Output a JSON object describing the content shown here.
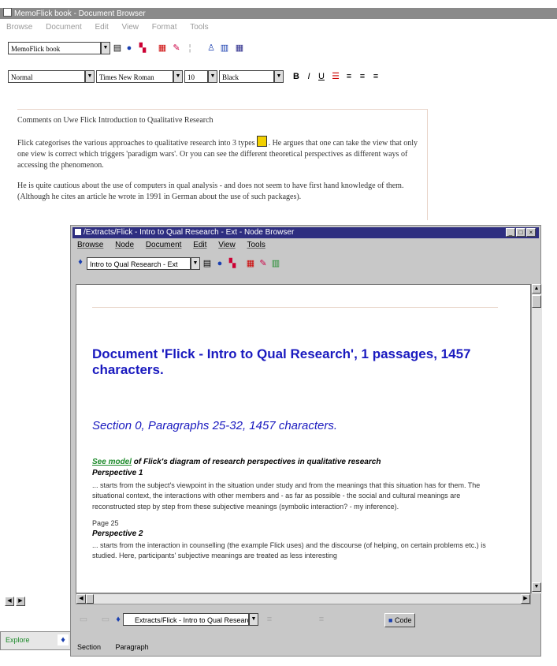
{
  "outer_window": {
    "title": "MemoFlick book - Document Browser",
    "menu": [
      "Browse",
      "Document",
      "Edit",
      "View",
      "Format",
      "Tools"
    ],
    "toolbar_top": {
      "document_combo": "MemoFlick book"
    },
    "toolbar_format": {
      "style_combo": "Normal",
      "font_combo": "Times New Roman",
      "size_combo": "10",
      "color_combo": "Black"
    },
    "document": {
      "heading": "Comments on Uwe Flick Introduction to Qualitative Research",
      "paragraph_1a": "Flick categorises the various approaches to qualitative research into 3 types",
      "paragraph_1b": ". He argues that one can take the view that only one view is correct which triggers 'paradigm wars'. Or you can see the different theoretical perspectives as different ways of accessing the phenomenon.",
      "paragraph_2": "He is quite cautious about the use of computers in qual analysis - and does not seem to have first hand knowledge of them. (Although he cites an article he wrote in 1991 in German about the use of such packages)."
    }
  },
  "inner_window": {
    "title": "/Extracts/Flick - Intro to Qual Research - Ext - Node Browser",
    "menu": [
      "Browse",
      "Node",
      "Document",
      "Edit",
      "View",
      "Tools"
    ],
    "toolbar_combo": "Intro to Qual Research - Ext",
    "document": {
      "heading": "Document 'Flick - Intro to Qual Research',  1 passages, 1457 characters.",
      "section": "Section 0, Paragraphs 25-32, 1457 characters.",
      "see_model_link": "See model",
      "see_model_rest": " of Flick's diagram of research perspectives in qualitative research",
      "perspective_1_title": "Perspective 1",
      "perspective_1_text": "... starts from the subject's viewpoint in the situation under study and from the meanings that this situation has for them.  The situational context, the interactions with other members and - as far as possible - the social and cultural meanings are reconstructed step by step from these subjective meanings (symbolic interaction? - my inference).",
      "page_ref": "Page 25",
      "perspective_2_title": "Perspective 2",
      "perspective_2_text": "... starts from the interaction in counselling (the example Flick uses) and the discourse (of helping, on certain problems etc.) is studied.  Here, participants' subjective meanings are treated as less interesting"
    },
    "bottom_toolbar": {
      "combo": "Extracts/Flick - Intro to Qual Research - Ext",
      "code_button": "Code"
    },
    "statusbar": [
      "Section",
      "Paragraph"
    ]
  },
  "outer_taskbar": [
    "Explore"
  ]
}
